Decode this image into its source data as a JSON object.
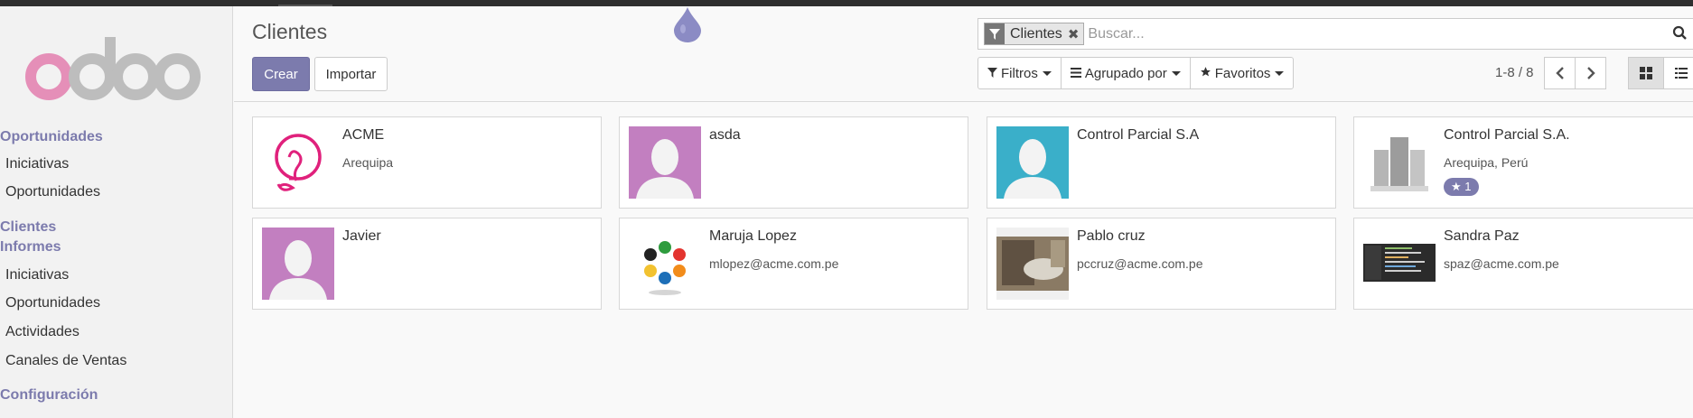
{
  "app": {
    "logo_text": "odoo"
  },
  "sidebar": {
    "sections": [
      {
        "title": "Oportunidades",
        "items": [
          "Iniciativas",
          "Oportunidades"
        ]
      },
      {
        "title": "Clientes",
        "items": []
      },
      {
        "title": "Informes",
        "items": [
          "Iniciativas",
          "Oportunidades",
          "Actividades",
          "Canales de Ventas"
        ]
      },
      {
        "title": "Configuración",
        "items": []
      }
    ]
  },
  "main": {
    "title": "Clientes",
    "create_label": "Crear",
    "import_label": "Importar"
  },
  "search": {
    "facet_label": "Clientes",
    "facet_remove": "✖",
    "placeholder": "Buscar...",
    "filters_label": "Filtros",
    "groupby_label": "Agrupado por",
    "favorites_label": "Favoritos"
  },
  "pager": {
    "value": "1-8 / 8"
  },
  "colors": {
    "accent": "#7c7bad",
    "sidebar_bg": "#f2f2f2"
  },
  "cards": [
    {
      "name": "ACME",
      "subtitle": "Arequipa",
      "avatar": "acme-logo",
      "badge": ""
    },
    {
      "name": "asda",
      "subtitle": "",
      "avatar": "placeholder-purple",
      "badge": ""
    },
    {
      "name": "Control Parcial S.A",
      "subtitle": "",
      "avatar": "placeholder-blue",
      "badge": ""
    },
    {
      "name": "Control Parcial S.A.",
      "subtitle": "Arequipa, Perú",
      "avatar": "company-buildings",
      "badge": "★ 1"
    },
    {
      "name": "Javier",
      "subtitle": "",
      "avatar": "placeholder-purple",
      "badge": ""
    },
    {
      "name": "Maruja Lopez",
      "subtitle": "mlopez@acme.com.pe",
      "avatar": "people-circle-logo",
      "badge": ""
    },
    {
      "name": "Pablo cruz",
      "subtitle": "pccruz@acme.com.pe",
      "avatar": "photo",
      "badge": ""
    },
    {
      "name": "Sandra Paz",
      "subtitle": "spaz@acme.com.pe",
      "avatar": "screenshot",
      "badge": ""
    }
  ]
}
